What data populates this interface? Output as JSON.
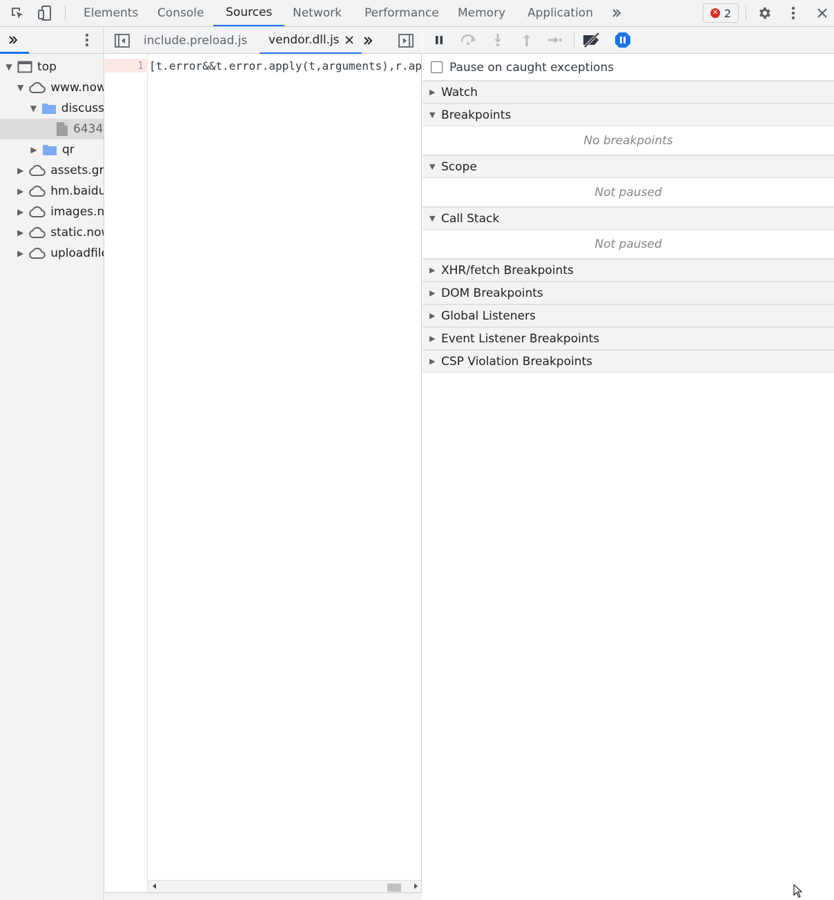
{
  "main_tabs": [
    "Elements",
    "Console",
    "Sources",
    "Network",
    "Performance",
    "Memory",
    "Application"
  ],
  "active_tab": "Sources",
  "error_count": "2",
  "navigator": {
    "tree": [
      {
        "label": "top"
      },
      {
        "label": "www.now"
      },
      {
        "label": "discuss"
      },
      {
        "label": "6434"
      },
      {
        "label": "qr"
      },
      {
        "label": "assets.gro"
      },
      {
        "label": "hm.baidu."
      },
      {
        "label": "images.nc"
      },
      {
        "label": "static.now"
      },
      {
        "label": "uploadfile"
      }
    ]
  },
  "editor": {
    "tabs": [
      {
        "label": "include.preload.js"
      },
      {
        "label": "vendor.dll.js"
      }
    ],
    "line_number": "1",
    "code_line": "[t.error&&t.error.apply(t,arguments),r.ap"
  },
  "debugger": {
    "pause_caught_label": "Pause on caught exceptions",
    "sections": {
      "watch": "Watch",
      "breakpoints": "Breakpoints",
      "breakpoints_empty": "No breakpoints",
      "scope": "Scope",
      "scope_empty": "Not paused",
      "callstack": "Call Stack",
      "callstack_empty": "Not paused",
      "xhr": "XHR/fetch Breakpoints",
      "dom": "DOM Breakpoints",
      "global": "Global Listeners",
      "event": "Event Listener Breakpoints",
      "csp": "CSP Violation Breakpoints"
    }
  },
  "colors": {
    "accent": "#1a73e8",
    "error": "#d93025",
    "pause_exceptions": "#1a73e8"
  }
}
